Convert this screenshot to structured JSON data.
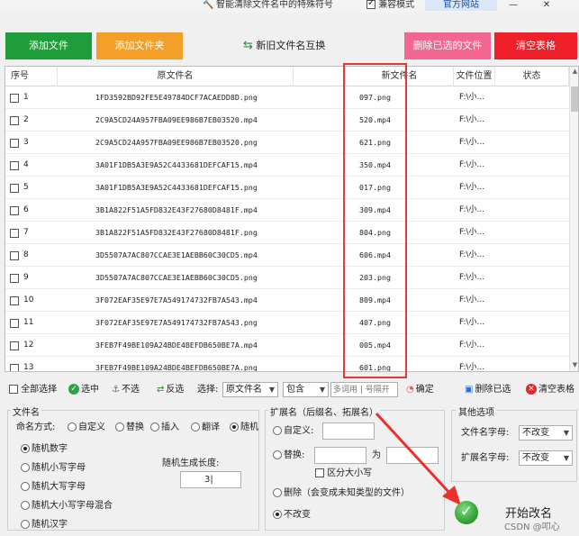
{
  "topbar": {
    "menu_label": "智能清除文件名中的特殊符号",
    "compat_label": "兼容模式",
    "compat_checked": true,
    "official_label": "官方网站",
    "minimize": "—",
    "close": "✕"
  },
  "toolbar": {
    "add_files": "添加文件",
    "add_folder": "添加文件夹",
    "swap_names": "新旧文件名互换",
    "delete_selected": "删除已选的文件",
    "clear_table": "清空表格",
    "colors": {
      "green": "#1f9d3a",
      "orange": "#f4a028",
      "pink": "#f2678f",
      "red": "#f0202a"
    }
  },
  "table": {
    "headers": {
      "index": "序号",
      "original": "原文件名",
      "newname": "新文件名",
      "location": "文件位置",
      "status": "状态"
    },
    "rows": [
      {
        "index": "1",
        "original": "1FD3592BD92FE5E49784DCF7ACAEDD8D.png",
        "newname": "097.png",
        "location": "F:\\小...",
        "status": ""
      },
      {
        "index": "2",
        "original": "2C9A5CD24A957FBA09EE986B7EB03520.mp4",
        "newname": "520.mp4",
        "location": "F:\\小...",
        "status": ""
      },
      {
        "index": "3",
        "original": "2C9A5CD24A957FBA09EE986B7EB03520.png",
        "newname": "621.png",
        "location": "F:\\小...",
        "status": ""
      },
      {
        "index": "4",
        "original": "3A01F1DB5A3E9A52C4433681DEFCAF15.mp4",
        "newname": "350.mp4",
        "location": "F:\\小...",
        "status": ""
      },
      {
        "index": "5",
        "original": "3A01F1DB5A3E9A52C4433681DEFCAF15.png",
        "newname": "017.png",
        "location": "F:\\小...",
        "status": ""
      },
      {
        "index": "6",
        "original": "3B1A822F51A5FD832E43F27680D8481F.mp4",
        "newname": "309.mp4",
        "location": "F:\\小...",
        "status": ""
      },
      {
        "index": "7",
        "original": "3B1A822F51A5FD832E43F27680D8481F.png",
        "newname": "804.png",
        "location": "F:\\小...",
        "status": ""
      },
      {
        "index": "8",
        "original": "3D5507A7AC807CCAE3E1AEBB60C30CD5.mp4",
        "newname": "606.mp4",
        "location": "F:\\小...",
        "status": ""
      },
      {
        "index": "9",
        "original": "3D5507A7AC807CCAE3E1AEBB60C30CD5.png",
        "newname": "203.png",
        "location": "F:\\小...",
        "status": ""
      },
      {
        "index": "10",
        "original": "3F072EAF35E97E7A549174732FB7A543.mp4",
        "newname": "809.mp4",
        "location": "F:\\小...",
        "status": ""
      },
      {
        "index": "11",
        "original": "3F072EAF35E97E7A549174732FB7A543.png",
        "newname": "407.png",
        "location": "F:\\小...",
        "status": ""
      },
      {
        "index": "12",
        "original": "3FEB7F49BE109A24BDE4BEFDB650BE7A.mp4",
        "newname": "005.mp4",
        "location": "F:\\小...",
        "status": ""
      },
      {
        "index": "13",
        "original": "3FEB7F49BE109A24BDE4BEFDB650BE7A.png",
        "newname": "601.png",
        "location": "F:\\小...",
        "status": ""
      }
    ],
    "highlight_color": "#e23a3a"
  },
  "bottombar": {
    "select_all": "全部选择",
    "select": "选中",
    "deselect": "不选",
    "invert": "反选",
    "choose_label": "选择:",
    "field_value": "原文件名",
    "mode_value": "包含",
    "keyword_placeholder": "多词用 | 号隔开",
    "confirm": "确定",
    "delete_selected": "删除已选",
    "clear_table": "清空表格"
  },
  "filename_group": {
    "title": "文件名",
    "mode_label": "命名方式:",
    "modes": [
      "自定义",
      "替换",
      "插入",
      "翻译",
      "随机"
    ],
    "selected_mode": "随机",
    "random_options": [
      "随机数字",
      "随机小写字母",
      "随机大写字母",
      "随机大小写字母混合",
      "随机汉字"
    ],
    "selected_random": "随机数字",
    "length_label": "随机生成长度:",
    "length_value": "3"
  },
  "ext_group": {
    "title": "扩展名（后缀名、拓展名）",
    "custom": "自定义:",
    "replace": "替换:",
    "to": "为",
    "case_sensitive": "区分大小写",
    "delete": "删除（会变成未知类型的文件）",
    "no_change": "不改变",
    "selected": "不改变"
  },
  "other_group": {
    "title": "其他选项",
    "filename_case_label": "文件名字母:",
    "filename_case_value": "不改变",
    "ext_case_label": "扩展名字母:",
    "ext_case_value": "不改变"
  },
  "start": {
    "label": "开始改名"
  },
  "watermark": "CSDN @叩心"
}
